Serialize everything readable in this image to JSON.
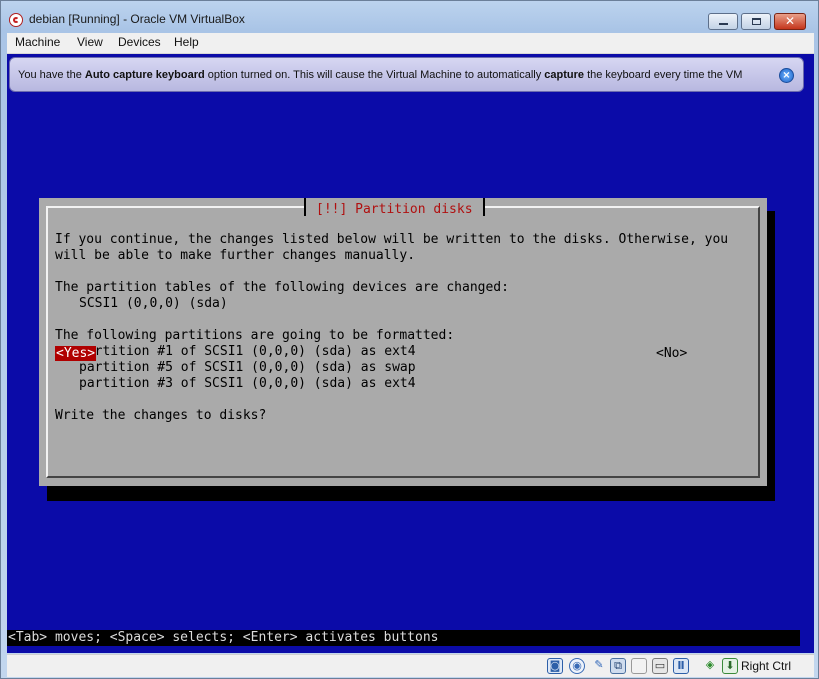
{
  "window": {
    "title": "debian [Running] - Oracle VM VirtualBox"
  },
  "menubar": {
    "items": [
      "Machine",
      "View",
      "Devices",
      "Help"
    ]
  },
  "notification": {
    "prefix": "You have the ",
    "bold1": "Auto capture keyboard",
    "middle": " option turned on. This will cause the Virtual Machine to automatically ",
    "bold2": "capture",
    "suffix": " the keyboard every time the VM"
  },
  "dialog": {
    "title": "[!!] Partition disks",
    "intro_line1": "If you continue, the changes listed below will be written to the disks. Otherwise, you",
    "intro_line2": "will be able to make further changes manually.",
    "tables_heading": "The partition tables of the following devices are changed:",
    "devices": [
      "SCSI1 (0,0,0) (sda)"
    ],
    "format_heading": "The following partitions are going to be formatted:",
    "partitions": [
      "partition #1 of SCSI1 (0,0,0) (sda) as ext4",
      "partition #5 of SCSI1 (0,0,0) (sda) as swap",
      "partition #3 of SCSI1 (0,0,0) (sda) as ext4"
    ],
    "question": "Write the changes to disks?",
    "yes_label": "<Yes>",
    "no_label": "<No>"
  },
  "help_line": "<Tab> moves; <Space> selects; <Enter> activates buttons",
  "statusbar": {
    "icons": [
      "hard-disk-icon",
      "optical-drive-icon",
      "usb-icon",
      "network-icon",
      "shared-folders-icon",
      "display-icon",
      "video-capture-icon",
      "mouse-integration-icon",
      "keyboard-capture-icon"
    ],
    "host_key": "Right Ctrl"
  },
  "colors": {
    "vm_background": "#0b0ba8",
    "dialog_background": "#aaaaaa",
    "dialog_title": "#b01010",
    "selected_button": "#b00000"
  }
}
